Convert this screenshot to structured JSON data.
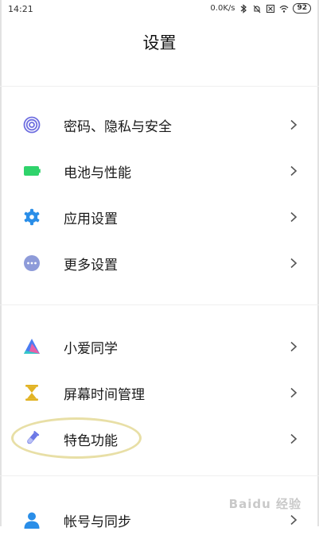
{
  "status_bar": {
    "time": "14:21",
    "speed": "0.0K/s",
    "battery": "92",
    "icons": [
      "bluetooth-icon",
      "mute-icon",
      "sim-off-icon",
      "wifi-icon"
    ]
  },
  "page": {
    "title": "设置"
  },
  "sections": [
    {
      "items": [
        {
          "label": "密码、隐私与安全",
          "icon": "fingerprint-icon",
          "color": "#6e6ee0"
        },
        {
          "label": "电池与性能",
          "icon": "battery-icon",
          "color": "#2fd36b"
        },
        {
          "label": "应用设置",
          "icon": "gear-icon",
          "color": "#2a8ee8"
        },
        {
          "label": "更多设置",
          "icon": "more-dots-icon",
          "color": "#8e9bd9"
        }
      ]
    },
    {
      "items": [
        {
          "label": "小爱同学",
          "icon": "xiaoai-icon",
          "color": "#4a7cf2"
        },
        {
          "label": "屏幕时间管理",
          "icon": "hourglass-icon",
          "color": "#e2b324"
        },
        {
          "label": "特色功能",
          "icon": "flask-icon",
          "color": "#6b78e6"
        }
      ]
    },
    {
      "items": [
        {
          "label": "帐号与同步",
          "icon": "account-icon",
          "color": "#2a8ee8"
        }
      ]
    }
  ],
  "watermark": "Baidu 经验"
}
